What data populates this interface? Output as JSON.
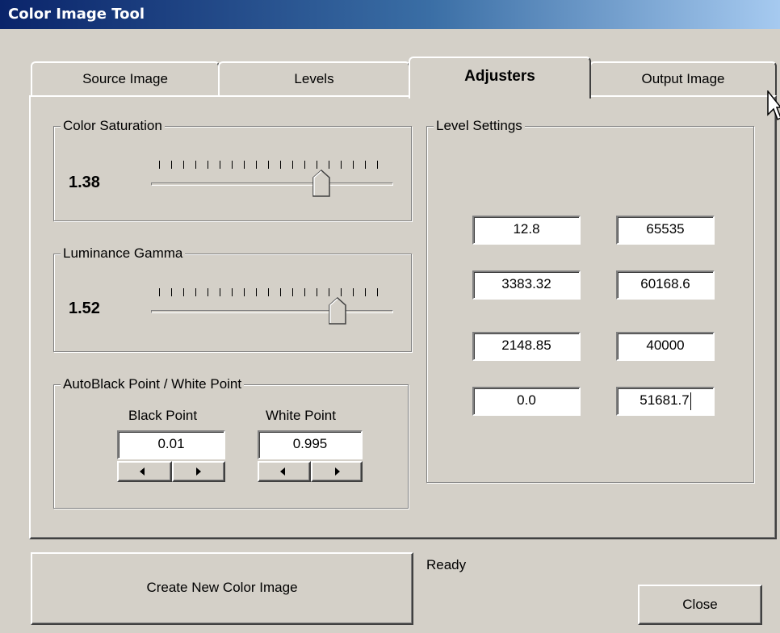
{
  "window": {
    "title": "Color Image Tool"
  },
  "tabs": [
    {
      "label": "Source Image"
    },
    {
      "label": "Levels"
    },
    {
      "label": "Adjusters",
      "active": true
    },
    {
      "label": "Output Image"
    }
  ],
  "color_saturation": {
    "legend": "Color Saturation",
    "value": "1.38",
    "slider_level": 0.72
  },
  "luminance_gamma": {
    "legend": "Luminance Gamma",
    "value": "1.52",
    "slider_level": 0.79
  },
  "auto_points": {
    "legend": "AutoBlack Point / White Point",
    "black_label": "Black Point",
    "black_value": "0.01",
    "white_label": "White Point",
    "white_value": "0.995"
  },
  "level_settings": {
    "legend": "Level Settings",
    "rows": [
      {
        "left": "12.8",
        "right": "65535"
      },
      {
        "left": "3383.32",
        "right": "60168.6"
      },
      {
        "left": "2148.85",
        "right": "40000"
      },
      {
        "left": "0.0",
        "right": "51681.7"
      }
    ]
  },
  "footer": {
    "create_button": "Create New Color Image",
    "status": "Ready",
    "close_button": "Close"
  },
  "icons": {
    "cursor": "mouse-pointer-icon",
    "spin_left": "triangle-left-icon",
    "spin_right": "triangle-right-icon"
  },
  "colors": {
    "face": "#d4d0c8",
    "title_start": "#0a246a",
    "title_end": "#a6caf0"
  }
}
